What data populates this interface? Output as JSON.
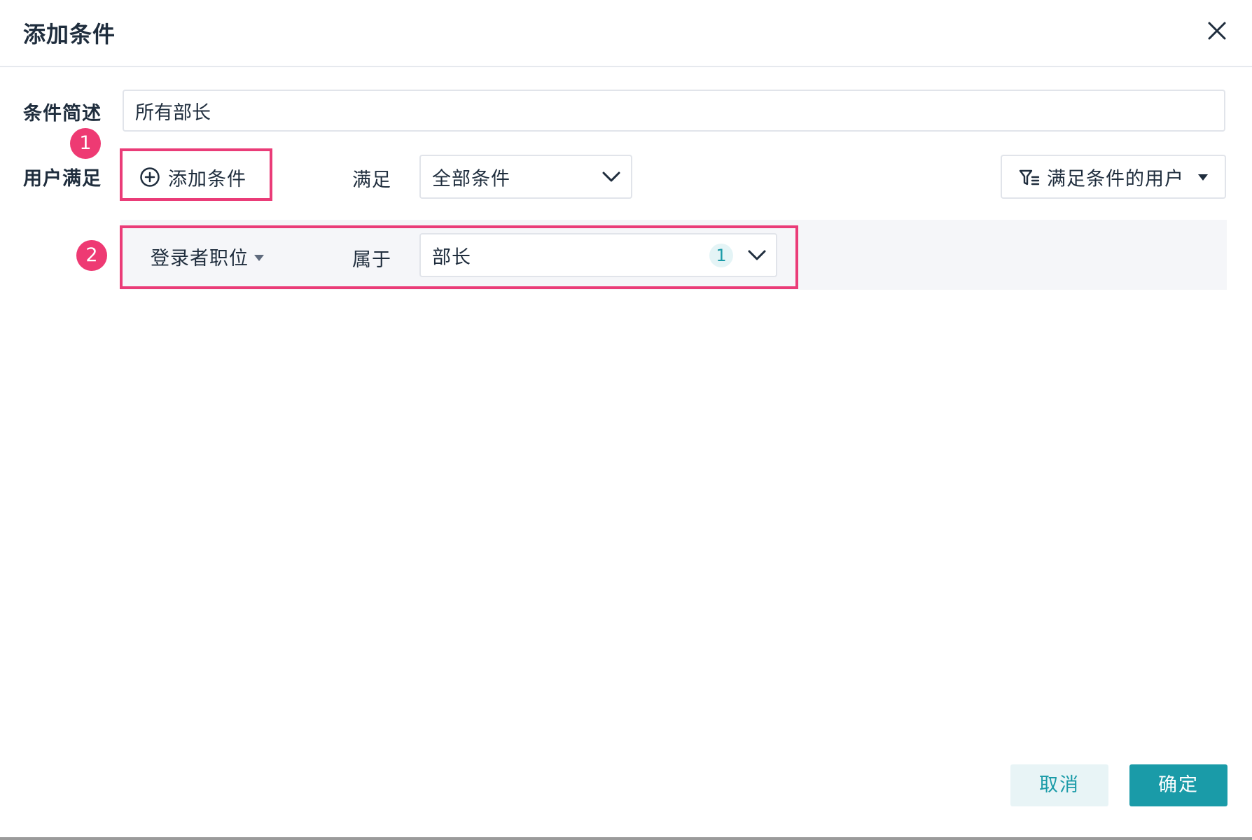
{
  "dialog": {
    "title": "添加条件"
  },
  "form": {
    "description_label": "条件简述",
    "description_value": "所有部长",
    "users_match_label": "用户满足"
  },
  "markers": {
    "first": "1",
    "second": "2"
  },
  "toolbar": {
    "add_condition_label": "添加条件",
    "match_label": "满足",
    "match_value": "全部条件",
    "filter_users_label": "满足条件的用户"
  },
  "condition": {
    "field": "登录者职位",
    "operator": "属于",
    "value": "部长",
    "count": "1"
  },
  "footer": {
    "cancel_label": "取消",
    "ok_label": "确定"
  },
  "colors": {
    "accent": "#1a9ba8",
    "highlight": "#ea3c78",
    "marker": "#ee3a73"
  },
  "icons": {
    "close": "close-icon",
    "add": "plus-circle-icon",
    "dropdown": "chevron-down-icon",
    "filter": "filter-icon",
    "caret": "caret-down-icon"
  }
}
